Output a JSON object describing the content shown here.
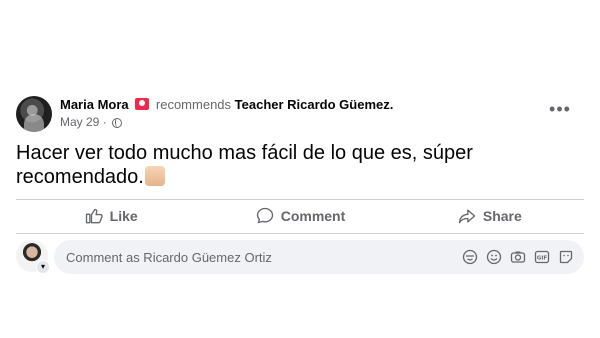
{
  "post": {
    "author": "Maria Mora",
    "verb": "recommends",
    "page_name": "Teacher Ricardo Güemez",
    "date": "May 29",
    "separator": "·",
    "content": "Hacer ver todo mucho mas fácil de lo que es, súper recomendado.",
    "more_label": "•••"
  },
  "actions": {
    "like": "Like",
    "comment": "Comment",
    "share": "Share"
  },
  "comment": {
    "placeholder": "Comment as Ricardo Güemez Ortiz"
  },
  "icons": {
    "recommend": "recommend-badge-icon",
    "audience": "globe-icon",
    "emoji_tail": "thumbs-up-emoji-icon",
    "tools": [
      "sticker-avatar-icon",
      "emoji-icon",
      "camera-icon",
      "gif-icon",
      "sticker-icon"
    ]
  },
  "colors": {
    "text_primary": "#050505",
    "text_secondary": "#65676b",
    "recommend_red": "#f02849",
    "comment_bg": "#f0f2f5",
    "divider": "#ced0d4"
  }
}
